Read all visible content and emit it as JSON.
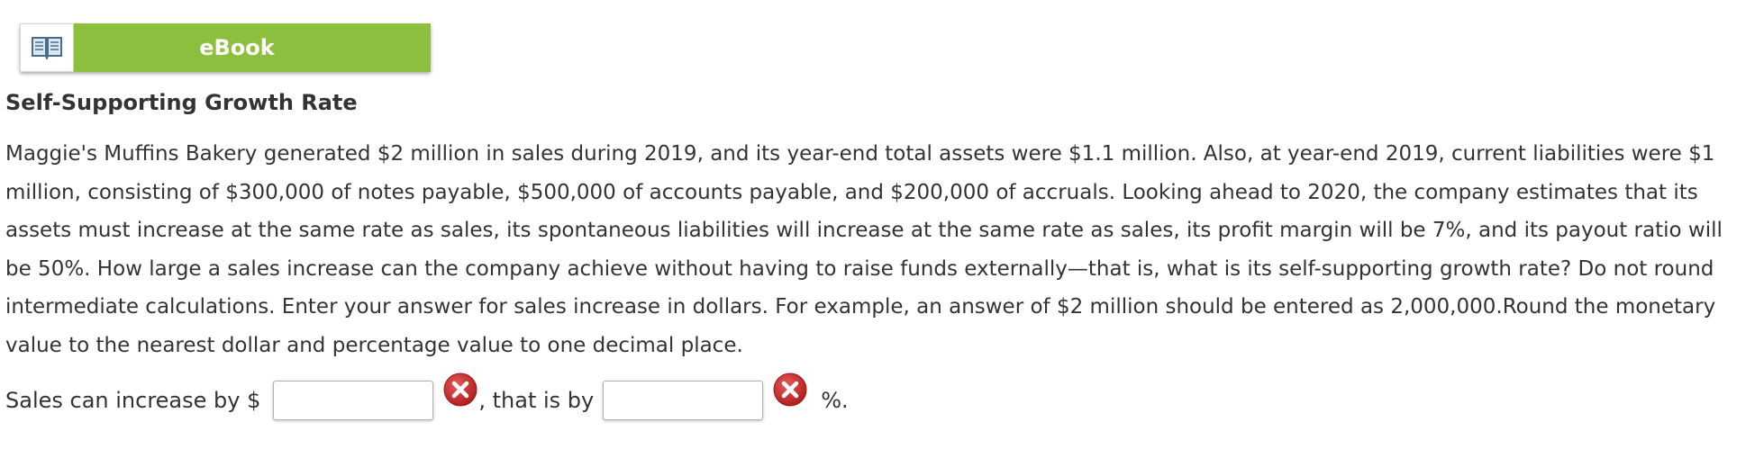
{
  "ebook": {
    "label": "eBook",
    "icon": "open-book-icon",
    "color": "#8dbf3e"
  },
  "title": "Self-Supporting Growth Rate",
  "problem_text": "Maggie's Muffins Bakery generated $2 million in sales during 2019, and its year-end total assets were $1.1 million. Also, at year-end 2019, current liabilities were $1 million, consisting of $300,000 of notes payable, $500,000 of accounts payable, and $200,000 of accruals. Looking ahead to 2020, the company estimates that its assets must increase at the same rate as sales, its spontaneous liabilities will increase at the same rate as sales, its profit margin will be 7%, and its payout ratio will be 50%. How large a sales increase can the company achieve without having to raise funds externally—that is, what is its self-supporting growth rate? Do not round intermediate calculations. Enter your answer for sales increase in dollars. For example, an answer of $2 million should be entered as 2,000,000.Round the monetary value to the nearest dollar and percentage value to one decimal place.",
  "answer": {
    "prefix": "Sales can increase by $",
    "sales_value": "",
    "middle": ", that is by",
    "percent_value": "",
    "suffix": "%.",
    "status_icon": "incorrect-x-icon",
    "status_color": "#c62828"
  }
}
